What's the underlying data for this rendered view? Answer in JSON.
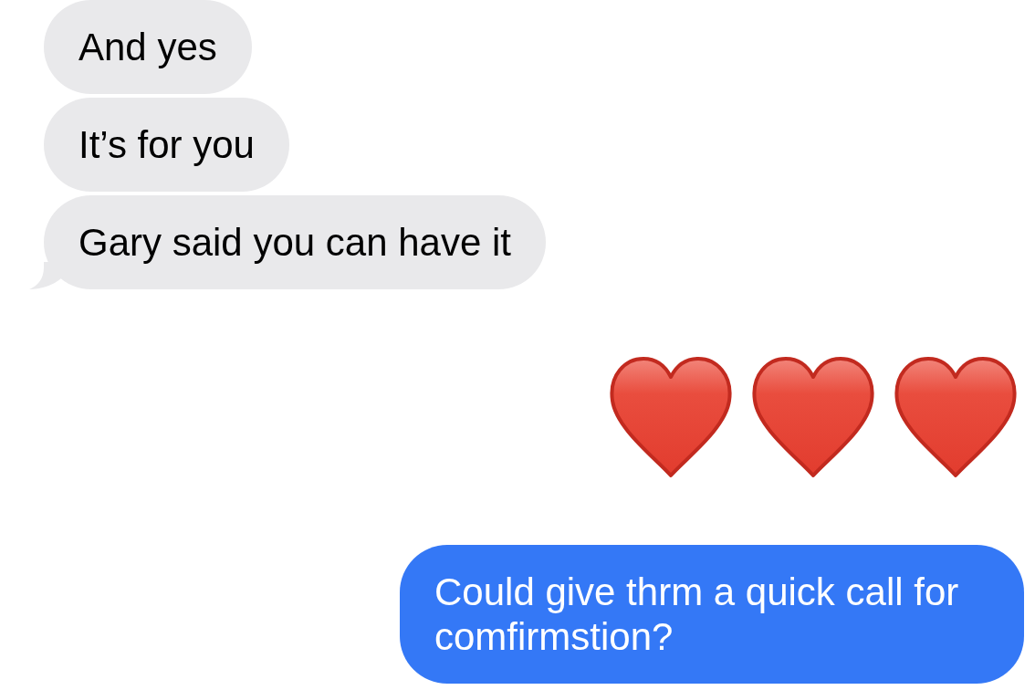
{
  "messages": [
    {
      "kind": "received",
      "text": "And yes",
      "tail": false
    },
    {
      "kind": "received",
      "text": "It’s for you",
      "tail": false
    },
    {
      "kind": "received",
      "text": "Gary said you can have it",
      "tail": true
    },
    {
      "kind": "emoji",
      "emoji": [
        {
          "kind": "heart"
        },
        {
          "kind": "heart"
        },
        {
          "kind": "heart"
        }
      ]
    },
    {
      "kind": "sent",
      "text": "Could give thrm a quick call for comfirmstion?",
      "tail": false
    }
  ]
}
